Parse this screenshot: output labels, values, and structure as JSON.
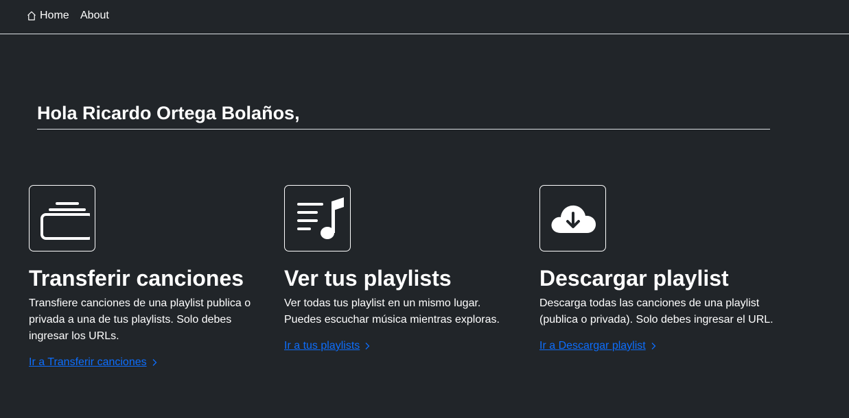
{
  "nav": {
    "home_label": "Home",
    "home_icon": "house-icon",
    "about_label": "About"
  },
  "greeting": "Hola Ricardo Ortega Bolaños,",
  "features": [
    {
      "icon": "collection-icon",
      "title": "Transferir canciones",
      "text": "Transfiere canciones de una playlist publica o privada a una de tus playlists. Solo debes ingresar los URLs.",
      "link": "Ir a Transferir canciones"
    },
    {
      "icon": "music-note-list-icon",
      "title": "Ver tus playlists",
      "text": "Ver todas tus playlist en un mismo lugar. Puedes escuchar música mientras exploras.",
      "link": "Ir a tus playlists"
    },
    {
      "icon": "cloud-download-icon",
      "title": "Descargar playlist",
      "text": "Descarga todas las canciones de una playlist (publica o privada). Solo debes ingresar el URL.",
      "link": "Ir a Descargar playlist"
    }
  ],
  "colors": {
    "background": "#212529",
    "link": "#0d6efd",
    "text": "#ffffff"
  }
}
